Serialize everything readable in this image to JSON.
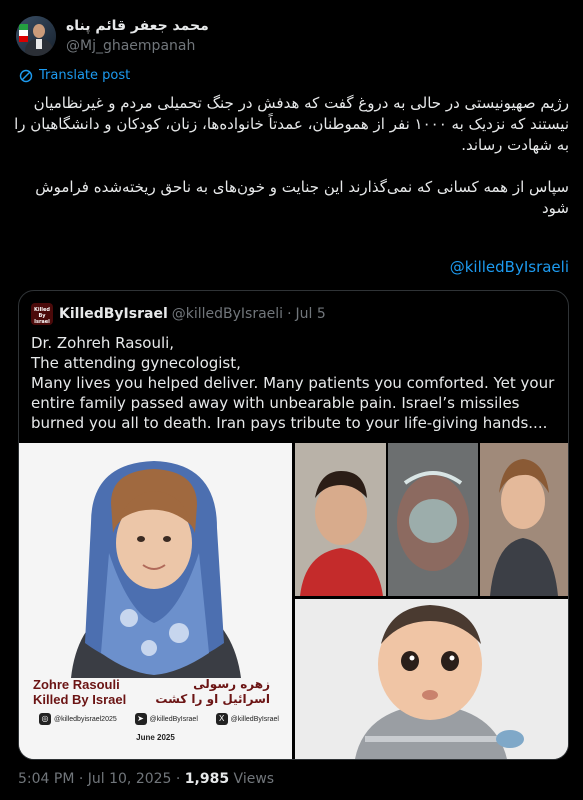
{
  "author": {
    "display_name": "محمد جعفر قائم پناه",
    "handle": "@Mj_ghaempanah"
  },
  "translate_label": "Translate post",
  "post": {
    "paragraph1": "رژیم صهیونیستی در حالی به دروغ گفت که هدفش در جنگ تحمیلی مردم و غیرنظامیان نیستند که نزدیک به ۱۰۰۰ نفر از هموطنان، عمدتاً خانواده‌ها، زنان، کودکان و دانشگاهیان را به شهادت رساند.",
    "paragraph2": "سپاس از همه کسانی که نمی‌گذارند این جنایت و خون‌های به ناحق ریخته‌شده فراموش شود",
    "hashtag": "@killedByIsraeli"
  },
  "quote": {
    "avatar_text": "Killed By Israel",
    "name": "KilledByIsrael",
    "handle": "@killedByIsraeli",
    "dot": "·",
    "date": "Jul 5",
    "lines": [
      "Dr. Zohreh Rasouli,",
      "The attending gynecologist,",
      "Many lives you helped deliver. Many patients you comforted. Yet your entire family passed away with unbearable pain. Israel’s missiles burned you all to death. Iran pays tribute to your life-giving hands...."
    ],
    "poster": {
      "name_en_line1": "Zohre Rasouli",
      "name_en_line2": "Killed By Israel",
      "name_fa_line1": "زهره رسولی",
      "name_fa_line2": "اسرائیل او را کشت",
      "social_instagram": "@killedbyisrael2025",
      "social_telegram": "@killedByIsrael",
      "social_x": "@killedByIsrael",
      "date": "June 2025"
    }
  },
  "footer": {
    "time": "5:04 PM · Jul 10, 2025 · ",
    "views_count": "1,985",
    "views_label": " Views"
  },
  "colors": {
    "background": "#000000",
    "text": "#e7e9ea",
    "muted": "#71767b",
    "link": "#1d9bf0",
    "border": "#2f3336"
  }
}
